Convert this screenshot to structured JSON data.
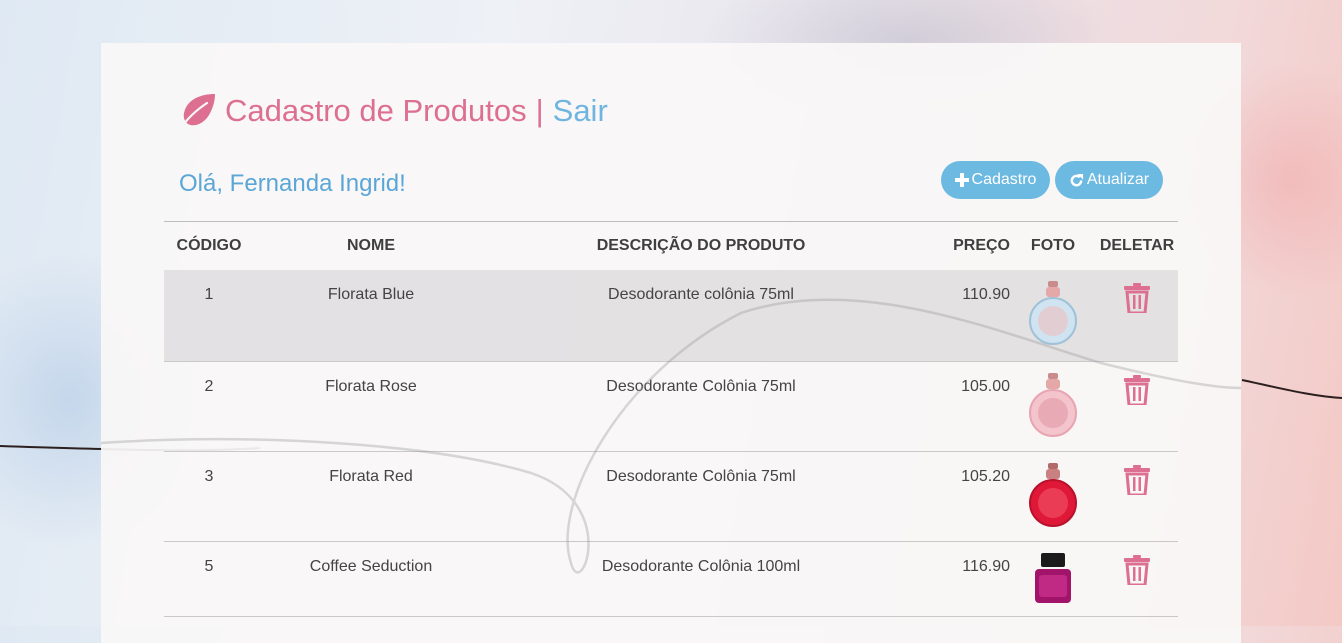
{
  "header": {
    "title": "Cadastro de Produtos",
    "separator": "|",
    "logout_label": "Sair"
  },
  "greeting": "Olá, Fernanda Ingrid!",
  "toolbar": {
    "add_label": "Cadastro",
    "refresh_label": "Atualizar"
  },
  "table": {
    "columns": [
      "CÓDIGO",
      "NOME",
      "DESCRIÇÃO DO PRODUTO",
      "PREÇO",
      "FOTO",
      "DELETAR"
    ],
    "rows": [
      {
        "codigo": "1",
        "nome": "Florata Blue",
        "descricao": "Desodorante colônia 75ml",
        "preco": "110.90",
        "foto": "perfume-bottle-blue"
      },
      {
        "codigo": "2",
        "nome": "Florata Rose",
        "descricao": "Desodorante Colônia 75ml",
        "preco": "105.00",
        "foto": "perfume-bottle-pink"
      },
      {
        "codigo": "3",
        "nome": "Florata Red",
        "descricao": "Desodorante Colônia 75ml",
        "preco": "105.20",
        "foto": "perfume-bottle-red"
      },
      {
        "codigo": "5",
        "nome": "Coffee Seduction",
        "descricao": "Desodorante Colônia 100ml",
        "preco": "116.90",
        "foto": "perfume-bottle-magenta"
      }
    ]
  },
  "icons": {
    "title": "leaf-icon",
    "add": "plus-icon",
    "refresh": "refresh-icon",
    "delete": "trash-icon"
  },
  "colors": {
    "accent_pink": "#dd6f91",
    "accent_blue": "#6cb9e2",
    "greeting_blue": "#5aa6d6",
    "row_highlight": "#dcdbdc"
  }
}
